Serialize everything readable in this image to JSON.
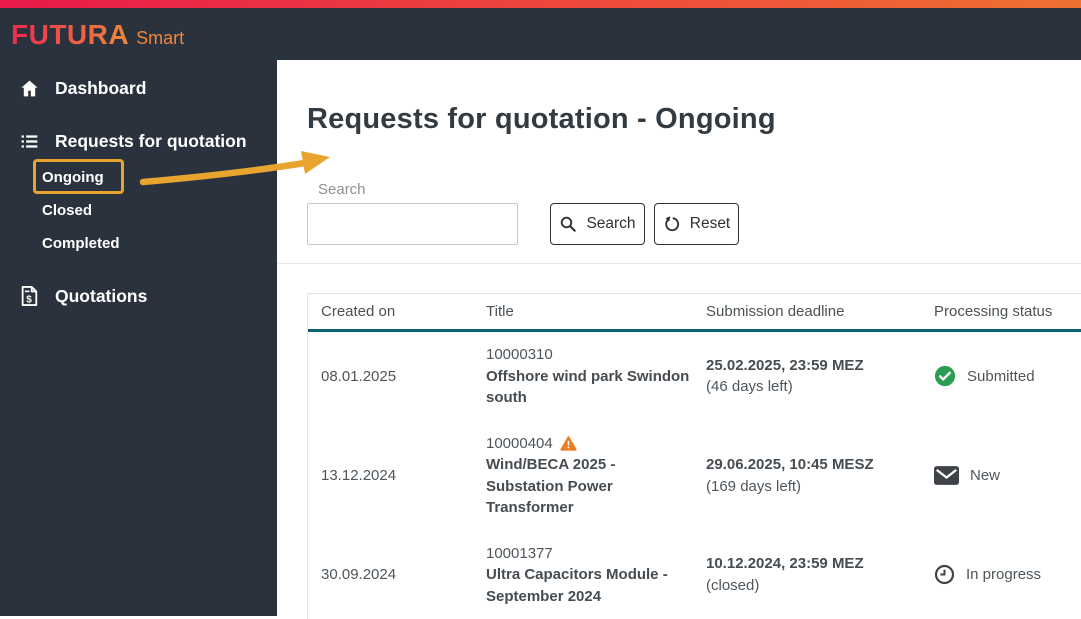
{
  "brand": {
    "name": "FUTURA",
    "suffix": "Smart"
  },
  "colors": {
    "header_bg": "#2a333d",
    "strip_gradient_start": "#e81a4b",
    "strip_gradient_end": "#ef7031",
    "logo_gradient_start": "#ee2a52",
    "logo_gradient_end": "#f0883a",
    "table_header_rule": "#0a6475",
    "status_submitted_green": "#2a9d52",
    "status_new_dark": "#3f4347",
    "warning_orange": "#ed7d23",
    "annotation_amber": "#e9a42f"
  },
  "sidebar": {
    "items": [
      {
        "label": "Dashboard",
        "icon": "home-icon"
      },
      {
        "label": "Requests for quotation",
        "icon": "list-icon",
        "children": [
          "Ongoing",
          "Closed",
          "Completed"
        ]
      },
      {
        "label": "Quotations",
        "icon": "receipt-icon"
      }
    ]
  },
  "page": {
    "title": "Requests for quotation - Ongoing"
  },
  "search": {
    "label": "Search",
    "value": "",
    "search_button": "Search",
    "reset_button": "Reset"
  },
  "table": {
    "columns": [
      "Created on",
      "Title",
      "Submission deadline",
      "Processing status"
    ],
    "rows": [
      {
        "created": "08.01.2025",
        "number": "10000310",
        "warning": false,
        "title": "Offshore wind park Swindon south",
        "deadline": "25.02.2025, 23:59 MEZ",
        "deadline_note": "(46 days left)",
        "status": {
          "icon": "check-circle-icon",
          "label": "Submitted"
        }
      },
      {
        "created": "13.12.2024",
        "number": "10000404",
        "warning": true,
        "title": "Wind/BECA 2025 - Substation Power Transformer",
        "deadline": "29.06.2025, 10:45 MESZ",
        "deadline_note": "(169 days left)",
        "status": {
          "icon": "envelope-icon",
          "label": "New"
        }
      },
      {
        "created": "30.09.2024",
        "number": "10001377",
        "warning": false,
        "title": "Ultra Capacitors Module - September 2024",
        "deadline": "10.12.2024, 23:59 MEZ",
        "deadline_note": "(closed)",
        "status": {
          "icon": "clock-icon",
          "label": "In progress"
        }
      }
    ]
  },
  "annotation": {
    "highlighted_item": "Ongoing"
  }
}
